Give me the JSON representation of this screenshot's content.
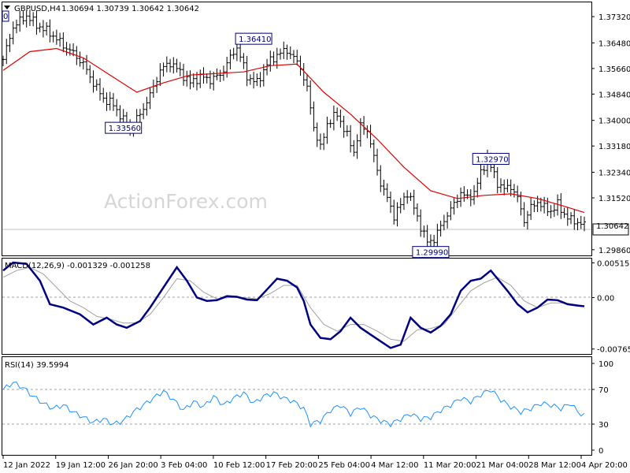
{
  "header": {
    "symbol": "GBPUSD,H4",
    "ohlc": "1.30694 1.30739 1.30642 1.30642",
    "tf_marker": "0"
  },
  "watermark": "ActionForex.com",
  "colors": {
    "price": "#000000",
    "ma": "#e00000",
    "macd": "#000080",
    "signal": "#a0a0a0",
    "rsi": "#1e90ff",
    "label": "#00007f"
  },
  "chart_data": [
    {
      "type": "ohlc-bar",
      "panel": "price",
      "symbol": "GBPUSD",
      "timeframe": "H4",
      "ylim": [
        1.2983,
        1.3765
      ],
      "yticks": [
        "1.37320",
        "1.36480",
        "1.35660",
        "1.34840",
        "1.34000",
        "1.33180",
        "1.32340",
        "1.31520",
        "1.30642",
        "1.29860"
      ],
      "current_price": "1.30642",
      "annotations": [
        {
          "text": "1.36410",
          "date": "Feb 9"
        },
        {
          "text": "1.33560",
          "date": "Jan 27"
        },
        {
          "text": "1.32970",
          "date": "Mar 23"
        },
        {
          "text": "1.29990",
          "date": "Mar 15"
        }
      ],
      "close_path": [
        [
          0,
          1.3595
        ],
        [
          3,
          1.37
        ],
        [
          7,
          1.3735
        ],
        [
          10,
          1.3705
        ],
        [
          14,
          1.368
        ],
        [
          18,
          1.364
        ],
        [
          21,
          1.3615
        ],
        [
          24,
          1.358
        ],
        [
          27,
          1.352
        ],
        [
          30,
          1.347
        ],
        [
          33,
          1.345
        ],
        [
          36,
          1.34
        ],
        [
          38,
          1.337
        ],
        [
          41,
          1.342
        ],
        [
          44,
          1.348
        ],
        [
          47,
          1.356
        ],
        [
          50,
          1.3585
        ],
        [
          53,
          1.3555
        ],
        [
          56,
          1.352
        ],
        [
          59,
          1.354
        ],
        [
          62,
          1.353
        ],
        [
          65,
          1.3545
        ],
        [
          68,
          1.36
        ],
        [
          70,
          1.3635
        ],
        [
          73,
          1.354
        ],
        [
          76,
          1.352
        ],
        [
          79,
          1.358
        ],
        [
          82,
          1.361
        ],
        [
          85,
          1.3625
        ],
        [
          87,
          1.36
        ],
        [
          89,
          1.357
        ],
        [
          91,
          1.35
        ],
        [
          93,
          1.338
        ],
        [
          95,
          1.331
        ],
        [
          97,
          1.339
        ],
        [
          100,
          1.342
        ],
        [
          103,
          1.335
        ],
        [
          105,
          1.33
        ],
        [
          107,
          1.338
        ],
        [
          109,
          1.337
        ],
        [
          111,
          1.328
        ],
        [
          113,
          1.32
        ],
        [
          115,
          1.315
        ],
        [
          117,
          1.3095
        ],
        [
          119,
          1.313
        ],
        [
          121,
          1.317
        ],
        [
          123,
          1.312
        ],
        [
          125,
          1.306
        ],
        [
          127,
          1.301
        ],
        [
          129,
          1.302
        ],
        [
          131,
          1.306
        ],
        [
          133,
          1.31
        ],
        [
          135,
          1.313
        ],
        [
          137,
          1.317
        ],
        [
          139,
          1.315
        ],
        [
          141,
          1.317
        ],
        [
          143,
          1.323
        ],
        [
          145,
          1.328
        ],
        [
          146,
          1.325
        ],
        [
          148,
          1.32
        ],
        [
          150,
          1.318
        ],
        [
          152,
          1.319
        ],
        [
          154,
          1.315
        ],
        [
          156,
          1.308
        ],
        [
          158,
          1.312
        ],
        [
          160,
          1.314
        ],
        [
          162,
          1.312
        ],
        [
          164,
          1.311
        ],
        [
          166,
          1.313
        ],
        [
          168,
          1.31
        ],
        [
          170,
          1.308
        ],
        [
          172,
          1.3075
        ],
        [
          174,
          1.3064
        ]
      ],
      "ma_path": [
        [
          0,
          1.356
        ],
        [
          8,
          1.362
        ],
        [
          16,
          1.363
        ],
        [
          24,
          1.36
        ],
        [
          32,
          1.3545
        ],
        [
          40,
          1.349
        ],
        [
          48,
          1.352
        ],
        [
          56,
          1.3545
        ],
        [
          64,
          1.355
        ],
        [
          72,
          1.3555
        ],
        [
          80,
          1.3575
        ],
        [
          88,
          1.358
        ],
        [
          96,
          1.349
        ],
        [
          104,
          1.342
        ],
        [
          112,
          1.334
        ],
        [
          120,
          1.325
        ],
        [
          128,
          1.3175
        ],
        [
          136,
          1.315
        ],
        [
          144,
          1.316
        ],
        [
          152,
          1.3165
        ],
        [
          160,
          1.315
        ],
        [
          168,
          1.3125
        ],
        [
          174,
          1.3105
        ]
      ]
    },
    {
      "type": "line",
      "panel": "macd",
      "title": "MACD(12,26,9) -0.001329 -0.001258",
      "ylim": [
        -0.0078,
        0.0052
      ],
      "yticks": [
        "0.005152",
        "0.00",
        "-0.00765"
      ],
      "series": [
        {
          "name": "MACD",
          "points": [
            [
              0,
              0.004
            ],
            [
              3,
              0.0052
            ],
            [
              7,
              0.005
            ],
            [
              11,
              0.0025
            ],
            [
              14,
              -0.001
            ],
            [
              18,
              -0.0015
            ],
            [
              23,
              -0.0025
            ],
            [
              27,
              -0.004
            ],
            [
              31,
              -0.003
            ],
            [
              34,
              -0.004
            ],
            [
              37,
              -0.0045
            ],
            [
              41,
              -0.0035
            ],
            [
              44,
              -0.0015
            ],
            [
              48,
              0.0015
            ],
            [
              52,
              0.0045
            ],
            [
              55,
              0.0025
            ],
            [
              58,
              0.0
            ],
            [
              61,
              -0.0005
            ],
            [
              64,
              -0.0004
            ],
            [
              67,
              0.0002
            ],
            [
              70,
              0.0001
            ],
            [
              73,
              -0.0003
            ],
            [
              76,
              -0.0004
            ],
            [
              79,
              0.0012
            ],
            [
              82,
              0.0028
            ],
            [
              85,
              0.0025
            ],
            [
              88,
              0.0015
            ],
            [
              90,
              -0.0005
            ],
            [
              92,
              -0.004
            ],
            [
              95,
              -0.006
            ],
            [
              98,
              -0.0062
            ],
            [
              101,
              -0.005
            ],
            [
              104,
              -0.003
            ],
            [
              107,
              -0.0045
            ],
            [
              110,
              -0.0055
            ],
            [
              113,
              -0.0065
            ],
            [
              116,
              -0.0075
            ],
            [
              119,
              -0.007
            ],
            [
              122,
              -0.003
            ],
            [
              125,
              -0.0045
            ],
            [
              128,
              -0.0052
            ],
            [
              131,
              -0.0042
            ],
            [
              134,
              -0.0025
            ],
            [
              137,
              0.001
            ],
            [
              140,
              0.0025
            ],
            [
              143,
              0.0028
            ],
            [
              146,
              0.004
            ],
            [
              148,
              0.0028
            ],
            [
              151,
              0.001
            ],
            [
              154,
              -0.001
            ],
            [
              157,
              -0.0022
            ],
            [
              160,
              -0.0015
            ],
            [
              163,
              -0.0003
            ],
            [
              166,
              -0.0004
            ],
            [
              169,
              -0.001
            ],
            [
              172,
              -0.0012
            ],
            [
              174,
              -0.0013
            ]
          ]
        },
        {
          "name": "Signal",
          "points": [
            [
              0,
              0.003
            ],
            [
              4,
              0.004
            ],
            [
              8,
              0.0045
            ],
            [
              12,
              0.0035
            ],
            [
              16,
              0.0015
            ],
            [
              20,
              -0.0005
            ],
            [
              24,
              -0.0015
            ],
            [
              28,
              -0.0028
            ],
            [
              32,
              -0.0032
            ],
            [
              36,
              -0.0038
            ],
            [
              40,
              -0.0038
            ],
            [
              44,
              -0.0025
            ],
            [
              48,
              0.0
            ],
            [
              52,
              0.0028
            ],
            [
              56,
              0.0025
            ],
            [
              60,
              0.0008
            ],
            [
              64,
              -0.0002
            ],
            [
              68,
              0.0
            ],
            [
              72,
              0.0
            ],
            [
              76,
              -0.0002
            ],
            [
              80,
              0.0006
            ],
            [
              84,
              0.0018
            ],
            [
              88,
              0.0018
            ],
            [
              92,
              -0.0015
            ],
            [
              96,
              -0.004
            ],
            [
              100,
              -0.005
            ],
            [
              104,
              -0.004
            ],
            [
              108,
              -0.004
            ],
            [
              112,
              -0.005
            ],
            [
              116,
              -0.0062
            ],
            [
              120,
              -0.0065
            ],
            [
              124,
              -0.0048
            ],
            [
              128,
              -0.0046
            ],
            [
              132,
              -0.004
            ],
            [
              136,
              -0.0015
            ],
            [
              140,
              0.001
            ],
            [
              144,
              0.0022
            ],
            [
              148,
              0.003
            ],
            [
              152,
              0.0018
            ],
            [
              156,
              -0.0005
            ],
            [
              160,
              -0.0015
            ],
            [
              164,
              -0.0008
            ],
            [
              168,
              -0.0008
            ],
            [
              172,
              -0.0011
            ],
            [
              174,
              -0.0013
            ]
          ]
        }
      ]
    },
    {
      "type": "line",
      "panel": "rsi",
      "title": "RSI(14) 39.5994",
      "ylim": [
        0,
        100
      ],
      "yticks": [
        "100",
        "70",
        "30",
        "0"
      ],
      "levels": [
        70,
        30
      ],
      "series": [
        {
          "name": "RSI",
          "points": [
            [
              0,
              70
            ],
            [
              3,
              78
            ],
            [
              6,
              72
            ],
            [
              9,
              62
            ],
            [
              12,
              54
            ],
            [
              15,
              48
            ],
            [
              18,
              52
            ],
            [
              21,
              44
            ],
            [
              24,
              38
            ],
            [
              27,
              32
            ],
            [
              30,
              36
            ],
            [
              33,
              30
            ],
            [
              36,
              34
            ],
            [
              39,
              44
            ],
            [
              42,
              52
            ],
            [
              45,
              60
            ],
            [
              48,
              68
            ],
            [
              51,
              58
            ],
            [
              54,
              46
            ],
            [
              57,
              56
            ],
            [
              60,
              50
            ],
            [
              63,
              62
            ],
            [
              66,
              52
            ],
            [
              69,
              60
            ],
            [
              72,
              66
            ],
            [
              75,
              54
            ],
            [
              78,
              62
            ],
            [
              81,
              66
            ],
            [
              84,
              60
            ],
            [
              87,
              56
            ],
            [
              90,
              48
            ],
            [
              92,
              30
            ],
            [
              95,
              34
            ],
            [
              98,
              46
            ],
            [
              101,
              52
            ],
            [
              104,
              42
            ],
            [
              107,
              50
            ],
            [
              110,
              40
            ],
            [
              113,
              34
            ],
            [
              116,
              30
            ],
            [
              119,
              36
            ],
            [
              122,
              42
            ],
            [
              125,
              36
            ],
            [
              128,
              38
            ],
            [
              131,
              46
            ],
            [
              134,
              52
            ],
            [
              137,
              60
            ],
            [
              140,
              56
            ],
            [
              143,
              64
            ],
            [
              146,
              70
            ],
            [
              149,
              58
            ],
            [
              152,
              50
            ],
            [
              155,
              44
            ],
            [
              158,
              48
            ],
            [
              161,
              54
            ],
            [
              164,
              52
            ],
            [
              167,
              48
            ],
            [
              170,
              54
            ],
            [
              172,
              44
            ],
            [
              174,
              40
            ]
          ]
        }
      ]
    }
  ],
  "x_axis": {
    "labels": [
      "12 Jan 2022",
      "19 Jan 12:00",
      "26 Jan 20:00",
      "3 Feb 04:00",
      "10 Feb 12:00",
      "17 Feb 20:00",
      "25 Feb 04:00",
      "4 Mar 12:00",
      "11 Mar 20:00",
      "21 Mar 04:00",
      "28 Mar 12:00",
      "4 Apr 20:00"
    ]
  }
}
